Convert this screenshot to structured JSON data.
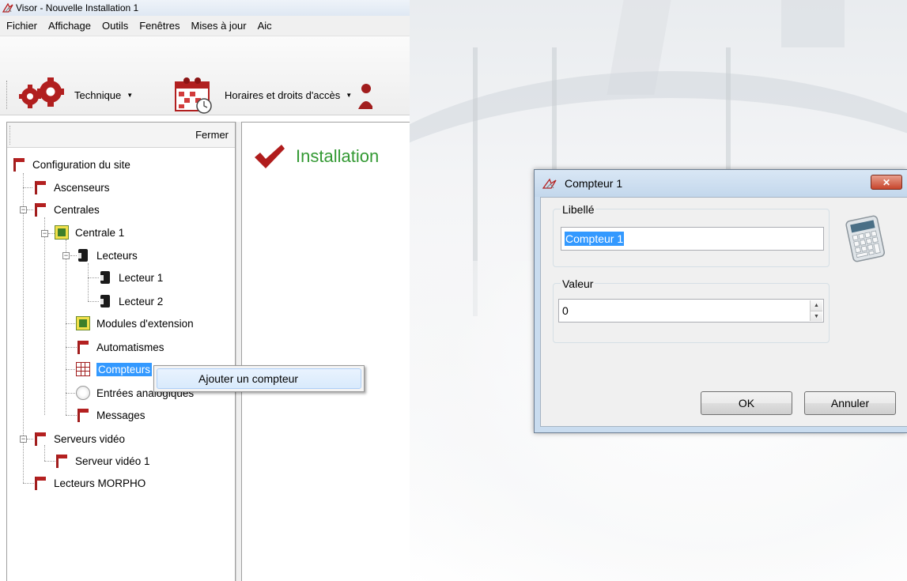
{
  "window": {
    "title": "Visor - Nouvelle Installation 1",
    "icon": "visor-logo-icon"
  },
  "menu": [
    "Fichier",
    "Affichage",
    "Outils",
    "Fenêtres",
    "Mises à jour",
    "Aic"
  ],
  "toolbar": {
    "technique": "Technique",
    "horaires": "Horaires et droits d'accès"
  },
  "left_panel": {
    "close_label": "Fermer"
  },
  "tree": {
    "config": "Configuration du site",
    "ascenseurs": "Ascenseurs",
    "centrales": "Centrales",
    "centrale1": "Centrale 1",
    "lecteurs": "Lecteurs",
    "lecteur1": "Lecteur 1",
    "lecteur2": "Lecteur 2",
    "modules": "Modules d'extension",
    "automatismes": "Automatismes",
    "compteurs": "Compteurs",
    "entrees": "Entrées analogiques",
    "messages": "Messages",
    "serveurs": "Serveurs vidéo",
    "serveur1": "Serveur vidéo 1",
    "morpho": "Lecteurs MORPHO"
  },
  "context_menu": {
    "add_counter": "Ajouter un compteur"
  },
  "content": {
    "title": "Installation"
  },
  "dialog": {
    "title": "Compteur 1",
    "libelle_label": "Libellé",
    "libelle_value": "Compteur 1",
    "valeur_label": "Valeur",
    "valeur_value": "0",
    "ok": "OK",
    "cancel": "Annuler",
    "close_glyph": "✕"
  },
  "colors": {
    "accent_red": "#a11d1d",
    "success_green": "#339933",
    "selection_blue": "#3399ff"
  }
}
